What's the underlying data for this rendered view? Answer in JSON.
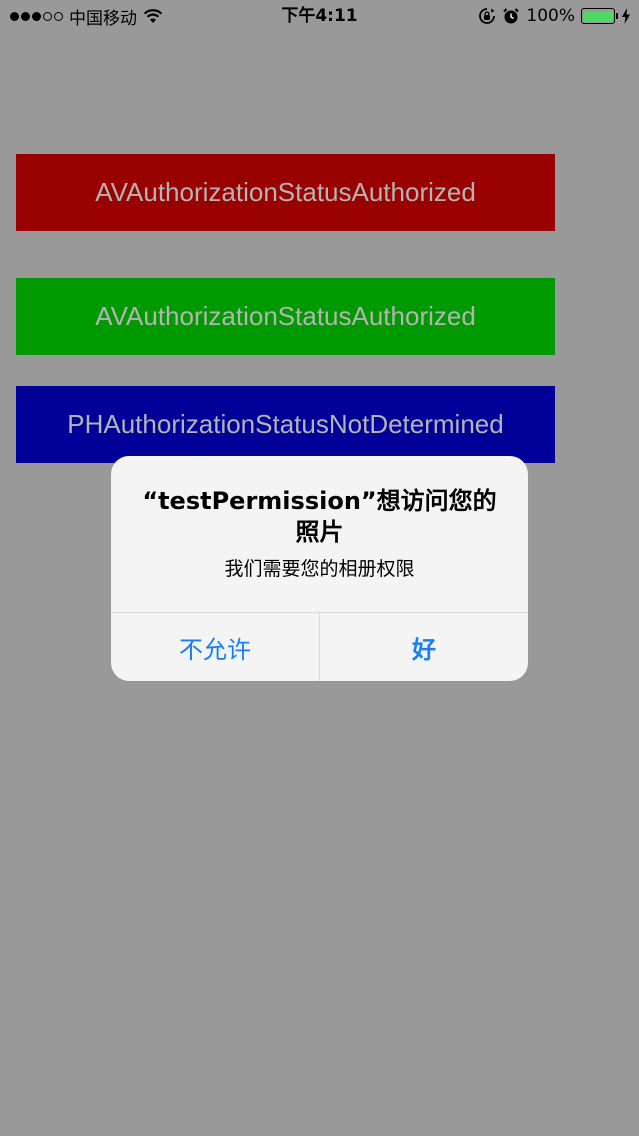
{
  "status_bar": {
    "carrier": "中国移动",
    "time": "下午4:11",
    "battery_percent": "100%",
    "battery_level": 1.0,
    "signal_bars_filled": 3,
    "signal_bars_total": 5,
    "icons": [
      "wifi-icon",
      "orientation-lock-icon",
      "alarm-icon",
      "battery-icon",
      "charging-bolt-icon"
    ]
  },
  "buttons": [
    {
      "label": "AVAuthorizationStatusAuthorized",
      "color": "#990000"
    },
    {
      "label": "AVAuthorizationStatusAuthorized",
      "color": "#009900"
    },
    {
      "label": "PHAuthorizationStatusNotDetermined",
      "color": "#000099"
    }
  ],
  "alert": {
    "title": "“testPermission”想访问您的照片",
    "message": "我们需要您的相册权限",
    "cancel_label": "不允许",
    "ok_label": "好",
    "button_color": "#157efb"
  },
  "colors": {
    "background": "#999999",
    "battery_fill": "#4cd964"
  }
}
